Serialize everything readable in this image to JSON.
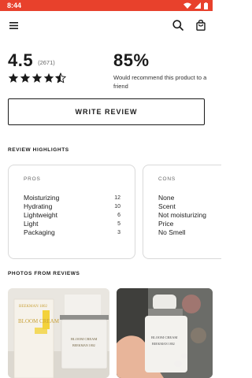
{
  "status_bar": {
    "time": "8:44"
  },
  "rating": {
    "value": "4.5",
    "count": "(2671)",
    "stars": 4.5
  },
  "recommend": {
    "percent": "85%",
    "text": "Would recommend this product to a friend"
  },
  "write_review_label": "WRITE REVIEW",
  "highlights": {
    "title": "REVIEW HIGHLIGHTS",
    "pros": {
      "label": "PROS",
      "items": [
        {
          "label": "Moisturizing",
          "count": "12"
        },
        {
          "label": "Hydrating",
          "count": "10"
        },
        {
          "label": "Lightweight",
          "count": "6"
        },
        {
          "label": "Light",
          "count": "5"
        },
        {
          "label": "Packaging",
          "count": "3"
        }
      ]
    },
    "cons": {
      "label": "CONS",
      "items": [
        {
          "label": "None"
        },
        {
          "label": "Scent"
        },
        {
          "label": "Not moisturizing"
        },
        {
          "label": "Price"
        },
        {
          "label": "No Smell"
        }
      ]
    }
  },
  "photos": {
    "title": "PHOTOS FROM REVIEWS",
    "photo_1": {
      "box_brand": "BEEKMAN 1802",
      "box_product": "BLOOM CREAM",
      "jar_brand": "BEEKMAN 1802",
      "jar_product": "BLOOM CREAM"
    },
    "photo_2": {
      "jar_product": "BLOOM CREAM",
      "jar_brand": "BEEKMAN 1802"
    }
  },
  "colors": {
    "status_bar": "#e8412c",
    "text": "#1a1a1a",
    "card_border": "#d9d9d9"
  },
  "icons": [
    "wifi-icon",
    "signal-icon",
    "battery-icon",
    "menu-icon",
    "search-icon",
    "shopping-bag-icon",
    "star-icon",
    "half-star-icon"
  ]
}
